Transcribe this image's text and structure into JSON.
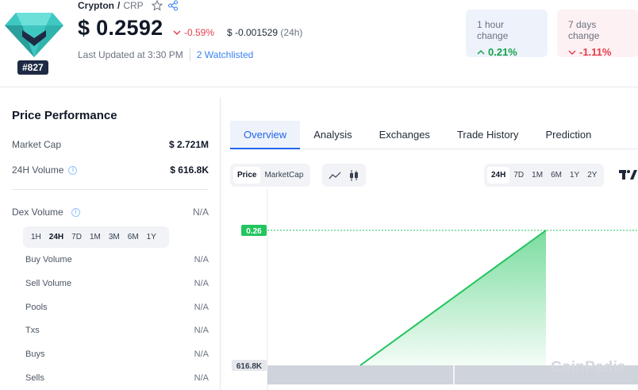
{
  "coin": {
    "name": "Crypton",
    "separator": "/",
    "symbol": "CRP",
    "rank": "#827",
    "price": "$ 0.2592",
    "pct_change": "-0.59%",
    "abs_change": "$ -0.001529",
    "abs_change_period": "(24h)",
    "last_updated": "Last Updated at 3:30 PM",
    "watchlisted": "2 Watchlisted"
  },
  "change_cards": [
    {
      "label": "1 hour change",
      "value": "0.21%",
      "direction": "up"
    },
    {
      "label": "7 days change",
      "value": "-1.11%",
      "direction": "down"
    }
  ],
  "performance": {
    "title": "Price Performance",
    "market_cap": {
      "label": "Market Cap",
      "value": "$ 2.721M"
    },
    "volume_24h": {
      "label": "24H Volume",
      "value": "$ 616.8K"
    },
    "dex_volume": {
      "label": "Dex Volume",
      "value": "N/A"
    },
    "periods": [
      "1H",
      "24H",
      "7D",
      "1M",
      "3M",
      "6M",
      "1Y"
    ],
    "active_period": "24H",
    "dex_rows": [
      {
        "label": "Buy Volume",
        "value": "N/A"
      },
      {
        "label": "Sell Volume",
        "value": "N/A"
      },
      {
        "label": "Pools",
        "value": "N/A"
      },
      {
        "label": "Txs",
        "value": "N/A"
      },
      {
        "label": "Buys",
        "value": "N/A"
      },
      {
        "label": "Sells",
        "value": "N/A"
      }
    ]
  },
  "tabs": [
    "Overview",
    "Analysis",
    "Exchanges",
    "Trade History",
    "Prediction"
  ],
  "active_tab": "Overview",
  "chart_toggles": {
    "metric": [
      "Price",
      "MarketCap"
    ],
    "active_metric": "Price",
    "ranges": [
      "24H",
      "7D",
      "1M",
      "6M",
      "1Y",
      "2Y"
    ],
    "active_range": "24H"
  },
  "watermark": "CoinPedia",
  "colors": {
    "accent": "#2563eb",
    "up": "#16a34a",
    "down": "#e53e4d",
    "line": "#22c55e",
    "price_label_bg": "#22c55e",
    "volume_label_bg": "#e5e7eb"
  },
  "chart_data": {
    "type": "area",
    "series": [
      {
        "values": [
          0.248,
          0.26
        ]
      }
    ],
    "price_label": "0.26",
    "volume_label": "616.8K",
    "volume_values": [
      616.8,
      616.8
    ]
  }
}
